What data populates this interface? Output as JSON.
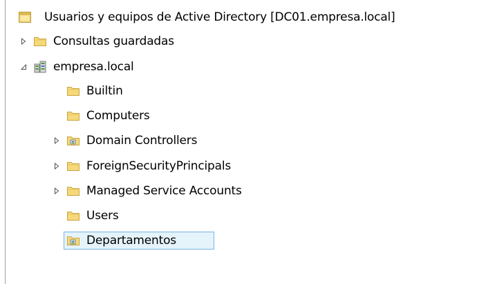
{
  "tree": {
    "root": {
      "label": "Usuarios y equipos de Active Directory [DC01.empresa.local]",
      "icon": "ad-console-icon"
    },
    "saved_queries": {
      "label": "Consultas guardadas",
      "expanded": false,
      "icon": "folder-icon"
    },
    "domain": {
      "label": "empresa.local",
      "expanded": true,
      "icon": "domain-icon",
      "children": [
        {
          "label": "Builtin",
          "icon": "folder-icon",
          "expander": false
        },
        {
          "label": "Computers",
          "icon": "folder-icon",
          "expander": false
        },
        {
          "label": "Domain Controllers",
          "icon": "ou-icon",
          "expander": true
        },
        {
          "label": "ForeignSecurityPrincipals",
          "icon": "folder-icon",
          "expander": true
        },
        {
          "label": "Managed Service Accounts",
          "icon": "folder-icon",
          "expander": true
        },
        {
          "label": "Users",
          "icon": "folder-icon",
          "expander": false
        },
        {
          "label": "Departamentos",
          "icon": "ou-icon",
          "expander": false,
          "selected": true
        }
      ]
    }
  },
  "colors": {
    "selection_bg": "#e5f3fb",
    "selection_border": "#7ab6de",
    "folder_yellow": "#f5d97a"
  }
}
